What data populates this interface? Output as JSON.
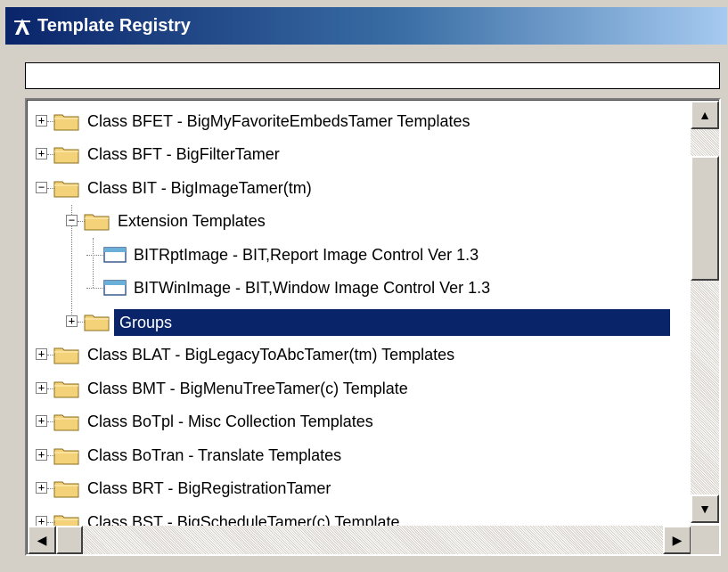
{
  "window": {
    "title": "Template Registry"
  },
  "filter": {
    "value": "",
    "placeholder": ""
  },
  "tree": {
    "items": [
      {
        "label": "Class BFET - BigMyFavoriteEmbedsTamer Templates",
        "level": 0,
        "expander": "+",
        "icon": "folder-icon"
      },
      {
        "label": "Class BFT - BigFilterTamer",
        "level": 0,
        "expander": "+",
        "icon": "folder-icon"
      },
      {
        "label": "Class BIT - BigImageTamer(tm)",
        "level": 0,
        "expander": "−",
        "icon": "folder-icon"
      },
      {
        "label": "Extension Templates",
        "level": 1,
        "expander": "−",
        "icon": "folder-icon"
      },
      {
        "label": "BITRptImage - BIT,Report Image Control Ver 1.3",
        "level": 2,
        "expander": "",
        "icon": "template-icon"
      },
      {
        "label": "BITWinImage - BIT,Window Image Control Ver 1.3",
        "level": 2,
        "expander": "",
        "icon": "template-icon"
      },
      {
        "label": "Groups",
        "level": 1,
        "expander": "+",
        "icon": "folder-icon",
        "selected": true
      },
      {
        "label": "Class BLAT - BigLegacyToAbcTamer(tm) Templates",
        "level": 0,
        "expander": "+",
        "icon": "folder-icon"
      },
      {
        "label": "Class BMT - BigMenuTreeTamer(c) Template",
        "level": 0,
        "expander": "+",
        "icon": "folder-icon"
      },
      {
        "label": "Class BoTpl - Misc Collection Templates",
        "level": 0,
        "expander": "+",
        "icon": "folder-icon"
      },
      {
        "label": "Class BoTran -  Translate Templates",
        "level": 0,
        "expander": "+",
        "icon": "folder-icon"
      },
      {
        "label": "Class BRT - BigRegistrationTamer",
        "level": 0,
        "expander": "+",
        "icon": "folder-icon"
      },
      {
        "label": "Class BST - BigScheduleTamer(c) Template",
        "level": 0,
        "expander": "+",
        "icon": "folder-icon"
      }
    ]
  },
  "scrollbar": {
    "up": "▲",
    "down": "▼",
    "left": "◀",
    "right": "▶"
  },
  "colors": {
    "selection": "#0a246a",
    "title_start": "#0a246a",
    "title_end": "#a6caf0",
    "face": "#d4d0c8"
  }
}
